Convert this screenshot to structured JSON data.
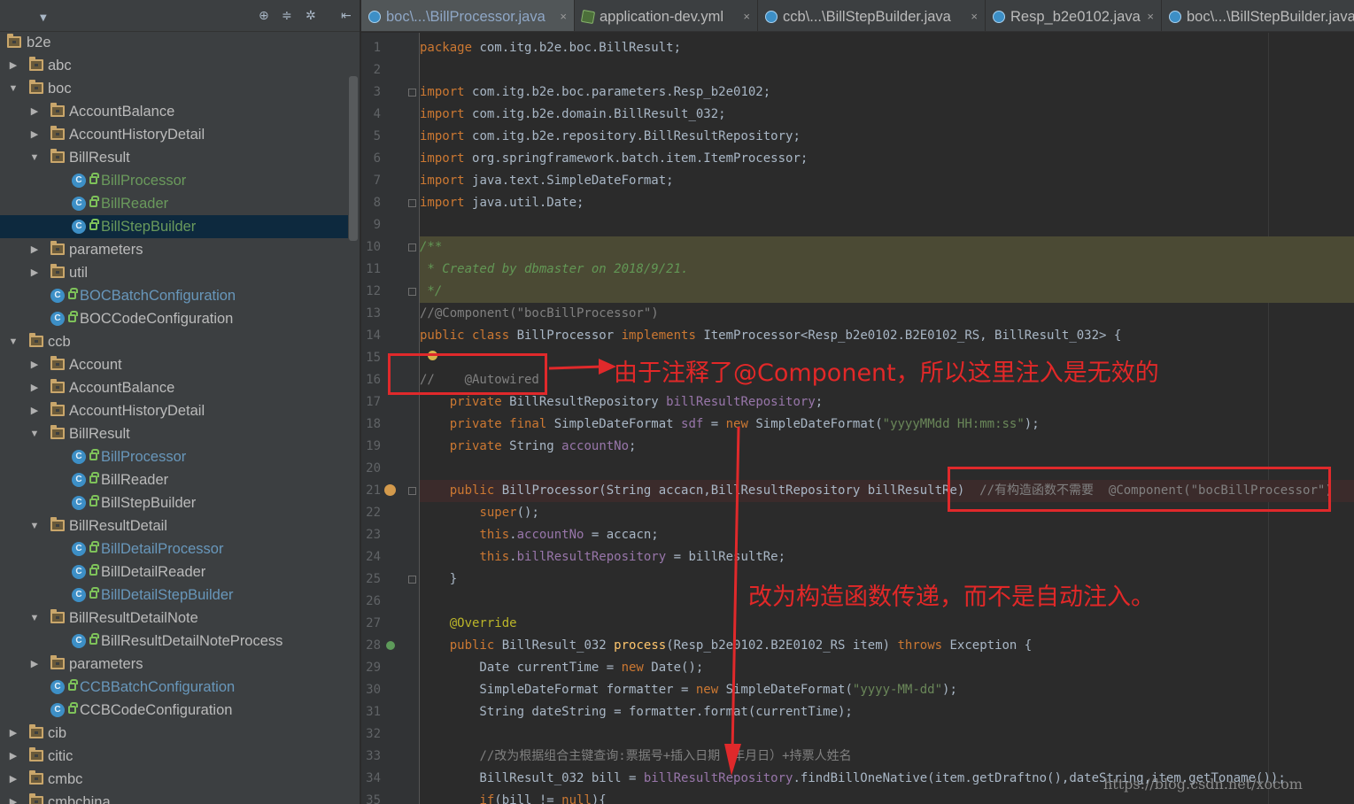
{
  "project_panel": {
    "toolbar_icons": [
      "target-icon",
      "collapse-icon",
      "gear-icon",
      "hide-icon"
    ],
    "tree": [
      {
        "label": "b2e",
        "type": "package",
        "depth": 0,
        "expanded": true
      },
      {
        "label": "abc",
        "type": "package",
        "depth": 1,
        "expanded": false
      },
      {
        "label": "boc",
        "type": "package",
        "depth": 1,
        "expanded": true
      },
      {
        "label": "AccountBalance",
        "type": "package",
        "depth": 2,
        "expanded": false
      },
      {
        "label": "AccountHistoryDetail",
        "type": "package",
        "depth": 2,
        "expanded": false
      },
      {
        "label": "BillResult",
        "type": "package",
        "depth": 2,
        "expanded": true
      },
      {
        "label": "BillProcessor",
        "type": "class",
        "depth": 3,
        "color": "green"
      },
      {
        "label": "BillReader",
        "type": "class",
        "depth": 3,
        "color": "green"
      },
      {
        "label": "BillStepBuilder",
        "type": "class",
        "depth": 3,
        "color": "green",
        "selected": true
      },
      {
        "label": "parameters",
        "type": "package",
        "depth": 2,
        "expanded": false
      },
      {
        "label": "util",
        "type": "package",
        "depth": 2,
        "expanded": false
      },
      {
        "label": "BOCBatchConfiguration",
        "type": "class",
        "depth": 2,
        "color": "blue"
      },
      {
        "label": "BOCCodeConfiguration",
        "type": "class",
        "depth": 2,
        "color": "default"
      },
      {
        "label": "ccb",
        "type": "package",
        "depth": 1,
        "expanded": true
      },
      {
        "label": "Account",
        "type": "package",
        "depth": 2,
        "expanded": false
      },
      {
        "label": "AccountBalance",
        "type": "package",
        "depth": 2,
        "expanded": false
      },
      {
        "label": "AccountHistoryDetail",
        "type": "package",
        "depth": 2,
        "expanded": false
      },
      {
        "label": "BillResult",
        "type": "package",
        "depth": 2,
        "expanded": true
      },
      {
        "label": "BillProcessor",
        "type": "class",
        "depth": 3,
        "color": "blue"
      },
      {
        "label": "BillReader",
        "type": "class",
        "depth": 3,
        "color": "default"
      },
      {
        "label": "BillStepBuilder",
        "type": "class",
        "depth": 3,
        "color": "default"
      },
      {
        "label": "BillResultDetail",
        "type": "package",
        "depth": 2,
        "expanded": true
      },
      {
        "label": "BillDetailProcessor",
        "type": "class",
        "depth": 3,
        "color": "blue"
      },
      {
        "label": "BillDetailReader",
        "type": "class",
        "depth": 3,
        "color": "default"
      },
      {
        "label": "BillDetailStepBuilder",
        "type": "class",
        "depth": 3,
        "color": "blue"
      },
      {
        "label": "BillResultDetailNote",
        "type": "package",
        "depth": 2,
        "expanded": true
      },
      {
        "label": "BillResultDetailNoteProcess",
        "type": "class",
        "depth": 3,
        "color": "default"
      },
      {
        "label": "parameters",
        "type": "package",
        "depth": 2,
        "expanded": false
      },
      {
        "label": "CCBBatchConfiguration",
        "type": "class",
        "depth": 2,
        "color": "blue"
      },
      {
        "label": "CCBCodeConfiguration",
        "type": "class",
        "depth": 2,
        "color": "default"
      },
      {
        "label": "cib",
        "type": "package",
        "depth": 1,
        "expanded": false
      },
      {
        "label": "citic",
        "type": "package",
        "depth": 1,
        "expanded": false
      },
      {
        "label": "cmbc",
        "type": "package",
        "depth": 1,
        "expanded": false
      },
      {
        "label": "cmbchina",
        "type": "package",
        "depth": 1,
        "expanded": false
      }
    ]
  },
  "editor_tabs": [
    {
      "label": "boc\\...\\BillProcessor.java",
      "icon": "class-icon",
      "active": true
    },
    {
      "label": "application-dev.yml",
      "icon": "yml-icon",
      "active": false
    },
    {
      "label": "ccb\\...\\BillStepBuilder.java",
      "icon": "class-icon",
      "active": false
    },
    {
      "label": "Resp_b2e0102.java",
      "icon": "class-icon",
      "active": false
    },
    {
      "label": "boc\\...\\BillStepBuilder.java",
      "icon": "class-icon",
      "active": false
    }
  ],
  "tab_close": "×",
  "code_lines": [
    [
      [
        "kw",
        "package "
      ],
      [
        "t",
        "com.itg.b2e.boc.BillResult;"
      ]
    ],
    [],
    [
      [
        "kw",
        "import "
      ],
      [
        "t",
        "com.itg.b2e.boc.parameters.Resp_b2e0102;"
      ]
    ],
    [
      [
        "kw",
        "import "
      ],
      [
        "t",
        "com.itg.b2e.domain.BillResult_032;"
      ]
    ],
    [
      [
        "kw",
        "import "
      ],
      [
        "t",
        "com.itg.b2e.repository.BillResultRepository;"
      ]
    ],
    [
      [
        "kw",
        "import "
      ],
      [
        "t",
        "org.springframework.batch.item.ItemProcessor;"
      ]
    ],
    [
      [
        "kw",
        "import "
      ],
      [
        "t",
        "java.text.SimpleDateFormat;"
      ]
    ],
    [
      [
        "kw",
        "import "
      ],
      [
        "t",
        "java.util.Date;"
      ]
    ],
    [],
    [
      [
        "doc",
        "/**"
      ]
    ],
    [
      [
        "doc",
        " * Created by dbmaster on 2018/9/21."
      ]
    ],
    [
      [
        "doc",
        " */"
      ]
    ],
    [
      [
        "cmt",
        "//@Component(\"bocBillProcessor\")"
      ]
    ],
    [
      [
        "kw",
        "public class "
      ],
      [
        "t",
        "BillProcessor "
      ],
      [
        "kw",
        "implements "
      ],
      [
        "t",
        "ItemProcessor<Resp_b2e0102.B2E0102_RS, BillResult_032> {"
      ]
    ],
    [],
    [
      [
        "cmt",
        "//    @Autowired"
      ]
    ],
    [
      [
        "t",
        "    "
      ],
      [
        "kw",
        "private "
      ],
      [
        "t",
        "BillResultRepository "
      ],
      [
        "fld",
        "billResultRepository"
      ],
      [
        "t",
        ";"
      ]
    ],
    [
      [
        "t",
        "    "
      ],
      [
        "kw",
        "private final "
      ],
      [
        "t",
        "SimpleDateFormat "
      ],
      [
        "fld",
        "sdf"
      ],
      [
        "t",
        " = "
      ],
      [
        "kw",
        "new "
      ],
      [
        "t",
        "SimpleDateFormat("
      ],
      [
        "str",
        "\"yyyyMMdd HH:mm:ss\""
      ],
      [
        "t",
        ");"
      ]
    ],
    [
      [
        "t",
        "    "
      ],
      [
        "kw",
        "private "
      ],
      [
        "t",
        "String "
      ],
      [
        "fld",
        "accountNo"
      ],
      [
        "t",
        ";"
      ]
    ],
    [],
    [
      [
        "t",
        "    "
      ],
      [
        "kw",
        "public "
      ],
      [
        "t",
        "BillProcessor(String accacn,BillResultRepository billResultRe)  "
      ],
      [
        "cmt",
        "//有构造函数不需要  @Component(\"bocBillProcessor\")"
      ]
    ],
    [
      [
        "t",
        "        "
      ],
      [
        "kw",
        "super"
      ],
      [
        "t",
        "();"
      ]
    ],
    [
      [
        "t",
        "        "
      ],
      [
        "kw",
        "this"
      ],
      [
        "t",
        "."
      ],
      [
        "fld",
        "accountNo"
      ],
      [
        "t",
        " = accacn;"
      ]
    ],
    [
      [
        "t",
        "        "
      ],
      [
        "kw",
        "this"
      ],
      [
        "t",
        "."
      ],
      [
        "fld",
        "billResultRepository"
      ],
      [
        "t",
        " = billResultRe;"
      ]
    ],
    [
      [
        "t",
        "    }"
      ]
    ],
    [],
    [
      [
        "t",
        "    "
      ],
      [
        "ann",
        "@Override"
      ]
    ],
    [
      [
        "t",
        "    "
      ],
      [
        "kw",
        "public "
      ],
      [
        "t",
        "BillResult_032 "
      ],
      [
        "meth",
        "process"
      ],
      [
        "t",
        "(Resp_b2e0102.B2E0102_RS item) "
      ],
      [
        "kw",
        "throws "
      ],
      [
        "t",
        "Exception {"
      ]
    ],
    [
      [
        "t",
        "        Date currentTime = "
      ],
      [
        "kw",
        "new "
      ],
      [
        "t",
        "Date();"
      ]
    ],
    [
      [
        "t",
        "        SimpleDateFormat formatter = "
      ],
      [
        "kw",
        "new "
      ],
      [
        "t",
        "SimpleDateFormat("
      ],
      [
        "str",
        "\"yyyy-MM-dd\""
      ],
      [
        "t",
        ");"
      ]
    ],
    [
      [
        "t",
        "        String dateString = formatter.format(currentTime);"
      ]
    ],
    [],
    [
      [
        "t",
        "        "
      ],
      [
        "cmt",
        "//改为根据组合主键查询:票据号+插入日期（年月日）+持票人姓名"
      ]
    ],
    [
      [
        "t",
        "        BillResult_032 bill = "
      ],
      [
        "fld",
        "billResultRepository"
      ],
      [
        "t",
        ".findBillOneNative(item.getDraftno(),dateString,item.getToname());"
      ]
    ],
    [
      [
        "t",
        "        "
      ],
      [
        "kw",
        "if"
      ],
      [
        "t",
        "(bill != "
      ],
      [
        "kw",
        "null"
      ],
      [
        "t",
        "){"
      ]
    ]
  ],
  "annotations": {
    "note1": "由于注释了@Component，所以这里注入是无效的",
    "note2": "改为构造函数传递，而不是自动注入。"
  },
  "watermark": "https://blog.csdn.net/xocom",
  "colors": {
    "annotation_red": "#e0292b",
    "keyword": "#cc7832",
    "string": "#6a8759",
    "comment": "#808080"
  }
}
